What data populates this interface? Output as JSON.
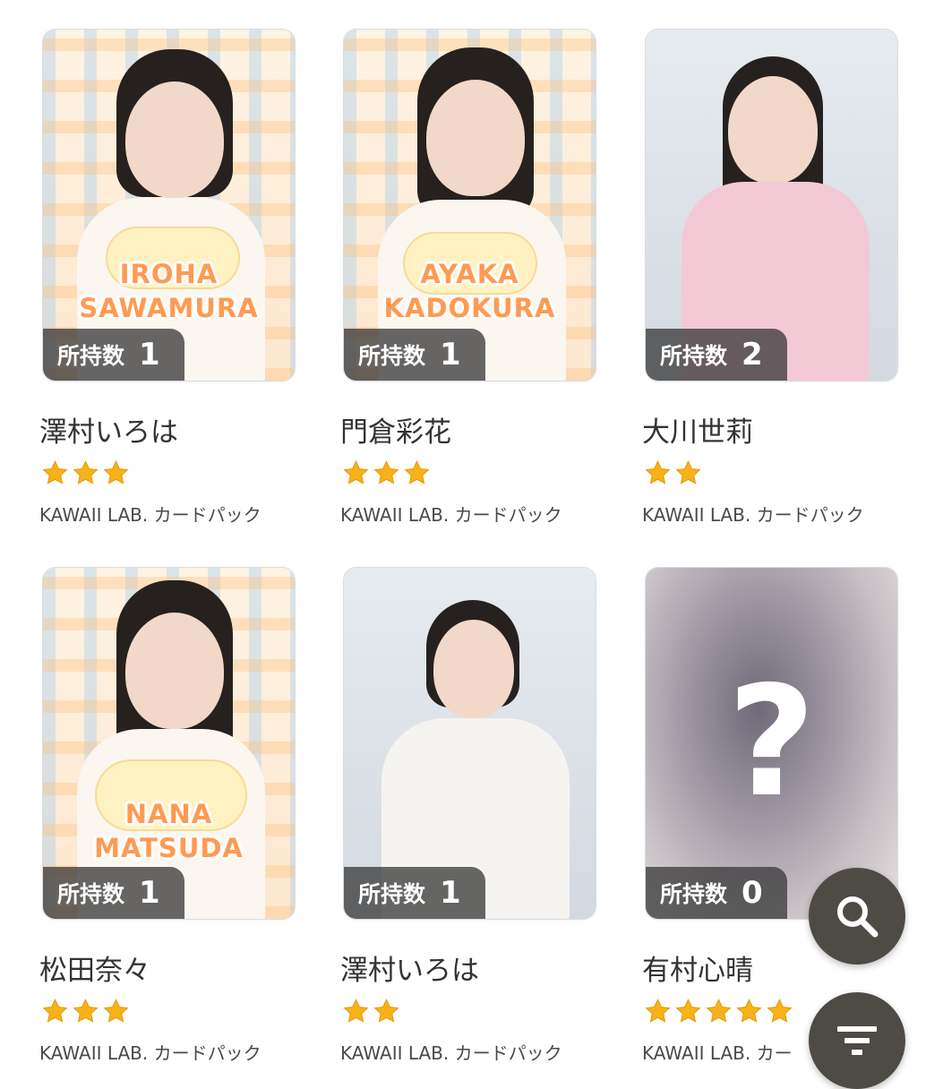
{
  "cards": [
    {
      "member_name": "澤村いろは",
      "name_art_line1": "IROHA",
      "name_art_line2": "SAWAMURA",
      "owned_label": "所持数",
      "owned_count": "1",
      "stars": 3,
      "pack": "KAWAII LAB. カードパック",
      "style": "plaid"
    },
    {
      "member_name": "門倉彩花",
      "name_art_line1": "AYAKA",
      "name_art_line2": "KADOKURA",
      "owned_label": "所持数",
      "owned_count": "1",
      "stars": 3,
      "pack": "KAWAII LAB. カードパック",
      "style": "plaid"
    },
    {
      "member_name": "大川世莉",
      "owned_label": "所持数",
      "owned_count": "2",
      "stars": 2,
      "pack": "KAWAII LAB. カードパック",
      "style": "studio"
    },
    {
      "member_name": "松田奈々",
      "name_art_line1": "NANA",
      "name_art_line2": "MATSUDA",
      "owned_label": "所持数",
      "owned_count": "1",
      "stars": 3,
      "pack": "KAWAII LAB. カードパック",
      "style": "plaid"
    },
    {
      "member_name": "澤村いろは",
      "owned_label": "所持数",
      "owned_count": "1",
      "stars": 2,
      "pack": "KAWAII LAB. カードパック",
      "style": "studio"
    },
    {
      "member_name": "有村心晴",
      "locked_symbol": "?",
      "owned_label": "所持数",
      "owned_count": "0",
      "stars": 5,
      "pack": "KAWAII LAB. カー",
      "style": "blur"
    }
  ],
  "fabs": {
    "search_icon": "search-icon",
    "filter_icon": "filter-icon"
  },
  "colors": {
    "star": "#f7b21a",
    "badge_bg": "#3c3c3c",
    "fab_bg": "#4e4a44",
    "name_art": "#ff9a52"
  }
}
